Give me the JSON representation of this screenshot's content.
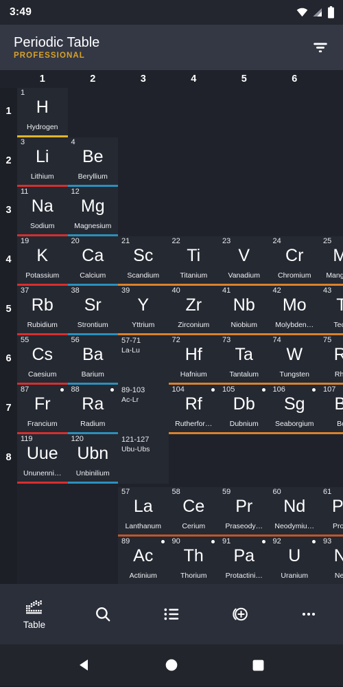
{
  "status_bar": {
    "time": "3:49",
    "icons": [
      "wifi-icon",
      "cellular-icon",
      "battery-icon"
    ]
  },
  "app_bar": {
    "title": "Periodic Table",
    "subtitle": "PROFESSIONAL",
    "subtitle_color": "#d8a22a",
    "action_icon": "filter-icon"
  },
  "table": {
    "column_headers": [
      "1",
      "2",
      "3",
      "4",
      "5",
      "6"
    ],
    "row_labels": [
      "1",
      "2",
      "3",
      "4",
      "5",
      "6",
      "7",
      "8"
    ],
    "category_colors": {
      "other-nonmetal": "#e0b62a",
      "alkali-metal": "#d62f2f",
      "alkaline-earth-metal": "#2b90bd",
      "transition-metal": "#d9822b",
      "lanthanide": "#c2552c"
    },
    "main_rows": [
      {
        "row": "1",
        "cells": [
          {
            "col": 1,
            "number": "1",
            "symbol": "H",
            "name": "Hydrogen",
            "color": "#e0b62a",
            "radioactive": false
          }
        ]
      },
      {
        "row": "2",
        "cells": [
          {
            "col": 1,
            "number": "3",
            "symbol": "Li",
            "name": "Lithium",
            "color": "#d62f2f",
            "radioactive": false
          },
          {
            "col": 2,
            "number": "4",
            "symbol": "Be",
            "name": "Beryllium",
            "color": "#2b90bd",
            "radioactive": false
          }
        ]
      },
      {
        "row": "3",
        "cells": [
          {
            "col": 1,
            "number": "11",
            "symbol": "Na",
            "name": "Sodium",
            "color": "#d62f2f",
            "radioactive": false
          },
          {
            "col": 2,
            "number": "12",
            "symbol": "Mg",
            "name": "Magnesium",
            "color": "#2b90bd",
            "radioactive": false
          }
        ]
      },
      {
        "row": "4",
        "cells": [
          {
            "col": 1,
            "number": "19",
            "symbol": "K",
            "name": "Potassium",
            "color": "#d62f2f",
            "radioactive": false
          },
          {
            "col": 2,
            "number": "20",
            "symbol": "Ca",
            "name": "Calcium",
            "color": "#2b90bd",
            "radioactive": false
          },
          {
            "col": 3,
            "number": "21",
            "symbol": "Sc",
            "name": "Scandium",
            "color": "#d9822b",
            "radioactive": false
          },
          {
            "col": 4,
            "number": "22",
            "symbol": "Ti",
            "name": "Titanium",
            "color": "#d9822b",
            "radioactive": false
          },
          {
            "col": 5,
            "number": "23",
            "symbol": "V",
            "name": "Vanadium",
            "color": "#d9822b",
            "radioactive": false
          },
          {
            "col": 6,
            "number": "24",
            "symbol": "Cr",
            "name": "Chromium",
            "color": "#d9822b",
            "radioactive": false
          },
          {
            "col": 7,
            "number": "25",
            "symbol": "Mn",
            "name": "Manganese",
            "color": "#d9822b",
            "radioactive": false
          }
        ]
      },
      {
        "row": "5",
        "cells": [
          {
            "col": 1,
            "number": "37",
            "symbol": "Rb",
            "name": "Rubidium",
            "color": "#d62f2f",
            "radioactive": false
          },
          {
            "col": 2,
            "number": "38",
            "symbol": "Sr",
            "name": "Strontium",
            "color": "#2b90bd",
            "radioactive": false
          },
          {
            "col": 3,
            "number": "39",
            "symbol": "Y",
            "name": "Yttrium",
            "color": "#d9822b",
            "radioactive": false
          },
          {
            "col": 4,
            "number": "40",
            "symbol": "Zr",
            "name": "Zirconium",
            "color": "#d9822b",
            "radioactive": false
          },
          {
            "col": 5,
            "number": "41",
            "symbol": "Nb",
            "name": "Niobium",
            "color": "#d9822b",
            "radioactive": false
          },
          {
            "col": 6,
            "number": "42",
            "symbol": "Mo",
            "name": "Molybden…",
            "color": "#d9822b",
            "radioactive": false
          },
          {
            "col": 7,
            "number": "43",
            "symbol": "Tc",
            "name": "Tech…",
            "color": "#d9822b",
            "radioactive": true
          }
        ]
      },
      {
        "row": "6",
        "cells": [
          {
            "col": 1,
            "number": "55",
            "symbol": "Cs",
            "name": "Caesium",
            "color": "#d62f2f",
            "radioactive": false
          },
          {
            "col": 2,
            "number": "56",
            "symbol": "Ba",
            "name": "Barium",
            "color": "#2b90bd",
            "radioactive": false
          },
          {
            "col": 3,
            "range_top": "57-71",
            "range_sub": "La-Lu",
            "placeholder": true
          },
          {
            "col": 4,
            "number": "72",
            "symbol": "Hf",
            "name": "Hafnium",
            "color": "#d9822b",
            "radioactive": false
          },
          {
            "col": 5,
            "number": "73",
            "symbol": "Ta",
            "name": "Tantalum",
            "color": "#d9822b",
            "radioactive": false
          },
          {
            "col": 6,
            "number": "74",
            "symbol": "W",
            "name": "Tungsten",
            "color": "#d9822b",
            "radioactive": false
          },
          {
            "col": 7,
            "number": "75",
            "symbol": "Re",
            "name": "Rhe…",
            "color": "#d9822b",
            "radioactive": false
          }
        ]
      },
      {
        "row": "7",
        "cells": [
          {
            "col": 1,
            "number": "87",
            "symbol": "Fr",
            "name": "Francium",
            "color": "#d62f2f",
            "radioactive": true
          },
          {
            "col": 2,
            "number": "88",
            "symbol": "Ra",
            "name": "Radium",
            "color": "#2b90bd",
            "radioactive": true
          },
          {
            "col": 3,
            "range_top": "89-103",
            "range_sub": "Ac-Lr",
            "placeholder": true
          },
          {
            "col": 4,
            "number": "104",
            "symbol": "Rf",
            "name": "Rutherfor…",
            "color": "#d9822b",
            "radioactive": true
          },
          {
            "col": 5,
            "number": "105",
            "symbol": "Db",
            "name": "Dubnium",
            "color": "#d9822b",
            "radioactive": true
          },
          {
            "col": 6,
            "number": "106",
            "symbol": "Sg",
            "name": "Seaborgium",
            "color": "#d9822b",
            "radioactive": true
          },
          {
            "col": 7,
            "number": "107",
            "symbol": "Bh",
            "name": "Bo…",
            "color": "#d9822b",
            "radioactive": true
          }
        ]
      },
      {
        "row": "8",
        "cells": [
          {
            "col": 1,
            "number": "119",
            "symbol": "Uue",
            "name": "Ununenni…",
            "color": "#d62f2f",
            "radioactive": false
          },
          {
            "col": 2,
            "number": "120",
            "symbol": "Ubn",
            "name": "Unbinilium",
            "color": "#2b90bd",
            "radioactive": false
          },
          {
            "col": 3,
            "range_top": "121-127",
            "range_sub": "Ubu-Ubs",
            "placeholder": true
          }
        ]
      }
    ],
    "lanthanide_row": {
      "cells": [
        {
          "col": 3,
          "number": "57",
          "symbol": "La",
          "name": "Lanthanum",
          "color": "#c2552c",
          "radioactive": false
        },
        {
          "col": 4,
          "number": "58",
          "symbol": "Ce",
          "name": "Cerium",
          "color": "#c2552c",
          "radioactive": false
        },
        {
          "col": 5,
          "number": "59",
          "symbol": "Pr",
          "name": "Praseody…",
          "color": "#c2552c",
          "radioactive": false
        },
        {
          "col": 6,
          "number": "60",
          "symbol": "Nd",
          "name": "Neodymiu…",
          "color": "#c2552c",
          "radioactive": false
        },
        {
          "col": 7,
          "number": "61",
          "symbol": "Pm",
          "name": "Prom…",
          "color": "#c2552c",
          "radioactive": true
        }
      ]
    },
    "actinide_row": {
      "cells": [
        {
          "col": 3,
          "number": "89",
          "symbol": "Ac",
          "name": "Actinium",
          "color": "#c2552c",
          "radioactive": true
        },
        {
          "col": 4,
          "number": "90",
          "symbol": "Th",
          "name": "Thorium",
          "color": "#c2552c",
          "radioactive": true
        },
        {
          "col": 5,
          "number": "91",
          "symbol": "Pa",
          "name": "Protactini…",
          "color": "#c2552c",
          "radioactive": true
        },
        {
          "col": 6,
          "number": "92",
          "symbol": "U",
          "name": "Uranium",
          "color": "#c2552c",
          "radioactive": true
        },
        {
          "col": 7,
          "number": "93",
          "symbol": "Np",
          "name": "Nep…",
          "color": "#c2552c",
          "radioactive": true
        }
      ]
    }
  },
  "bottom_nav": {
    "items": [
      {
        "icon": "table-grid-icon",
        "label": "Table",
        "selected": true
      },
      {
        "icon": "search-icon",
        "label": "",
        "selected": false
      },
      {
        "icon": "list-icon",
        "label": "",
        "selected": false
      },
      {
        "icon": "add-circle-icon",
        "label": "",
        "selected": false
      },
      {
        "icon": "more-horizontal-icon",
        "label": "",
        "selected": false
      }
    ]
  },
  "android_nav": {
    "back": "back-triangle-icon",
    "home": "home-circle-icon",
    "recents": "recents-square-icon"
  }
}
